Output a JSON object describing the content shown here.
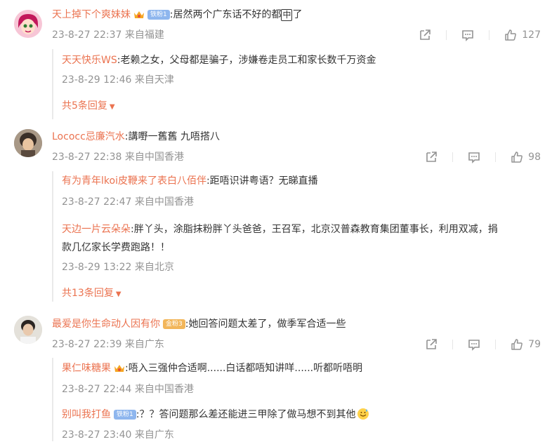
{
  "comments": [
    {
      "user": "天上掉下个爽妹妹",
      "badge": "铁粉1",
      "text_before": ":居然两个广东话不好的都",
      "boxed": "中",
      "text_after": "了",
      "time": "23-8-27 22:37 来自福建",
      "likes": "127",
      "replies": [
        {
          "user": "天天快乐WS",
          "text": ":老赖之女，父母都是骗子，涉嫌卷走员工和家长数千万资金",
          "time": "23-8-29 12:46 来自天津"
        }
      ],
      "more": "共5条回复"
    },
    {
      "user": "Lococc忌廉汽水",
      "text": ":講嘢一舊舊 九唔搭八",
      "time": "23-8-27 22:38 来自中国香港",
      "likes": "98",
      "replies": [
        {
          "user": "有为青年lkoi皮鞭来了表白八佰伴",
          "text": ":距唔识讲粤语？无睇直播",
          "time": "23-8-27 22:47 来自中国香港"
        },
        {
          "user": "天边一片云朵朵",
          "text": ":胖丫头，涂脂抹粉胖丫头爸爸，王召军，北京汉普森教育集团董事长，利用双减，捐款几亿家长学费跑路！！",
          "time": "23-8-29 13:22 来自北京"
        }
      ],
      "more": "共13条回复"
    },
    {
      "user": "最爱是你生命动人因有你",
      "badge": "金粉3",
      "text": ":她回答问题太差了，做季军合适一些",
      "time": "23-8-27 22:39 来自广东",
      "likes": "79",
      "replies": [
        {
          "user": "果仁味糖果",
          "text": ":唔入三强仲合适啊......白话都唔知讲咩......听都听唔明",
          "time": "23-8-27 22:44 来自中国香港"
        },
        {
          "user": "别叫我打鱼",
          "badge": "铁粉1",
          "text": ":？？答问题那么差还能进三甲除了做马想不到其他",
          "time": "23-8-27 23:40 来自广东"
        }
      ]
    }
  ],
  "colors": {
    "username": "#eb7350",
    "meta": "#939393",
    "text": "#333333"
  }
}
